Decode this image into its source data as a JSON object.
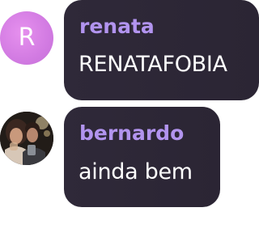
{
  "messages": [
    {
      "author": "renata",
      "avatar_initial": "R",
      "text": "RENATAFOBIA"
    },
    {
      "author": "bernardo",
      "avatar_image": "couple-photo",
      "text": "ainda bem"
    }
  ],
  "colors": {
    "author_name": "#b294ef",
    "bubble_bg": "#2d2737",
    "message_text": "#ffffff",
    "avatar_renata_bg": "#d27be2"
  }
}
